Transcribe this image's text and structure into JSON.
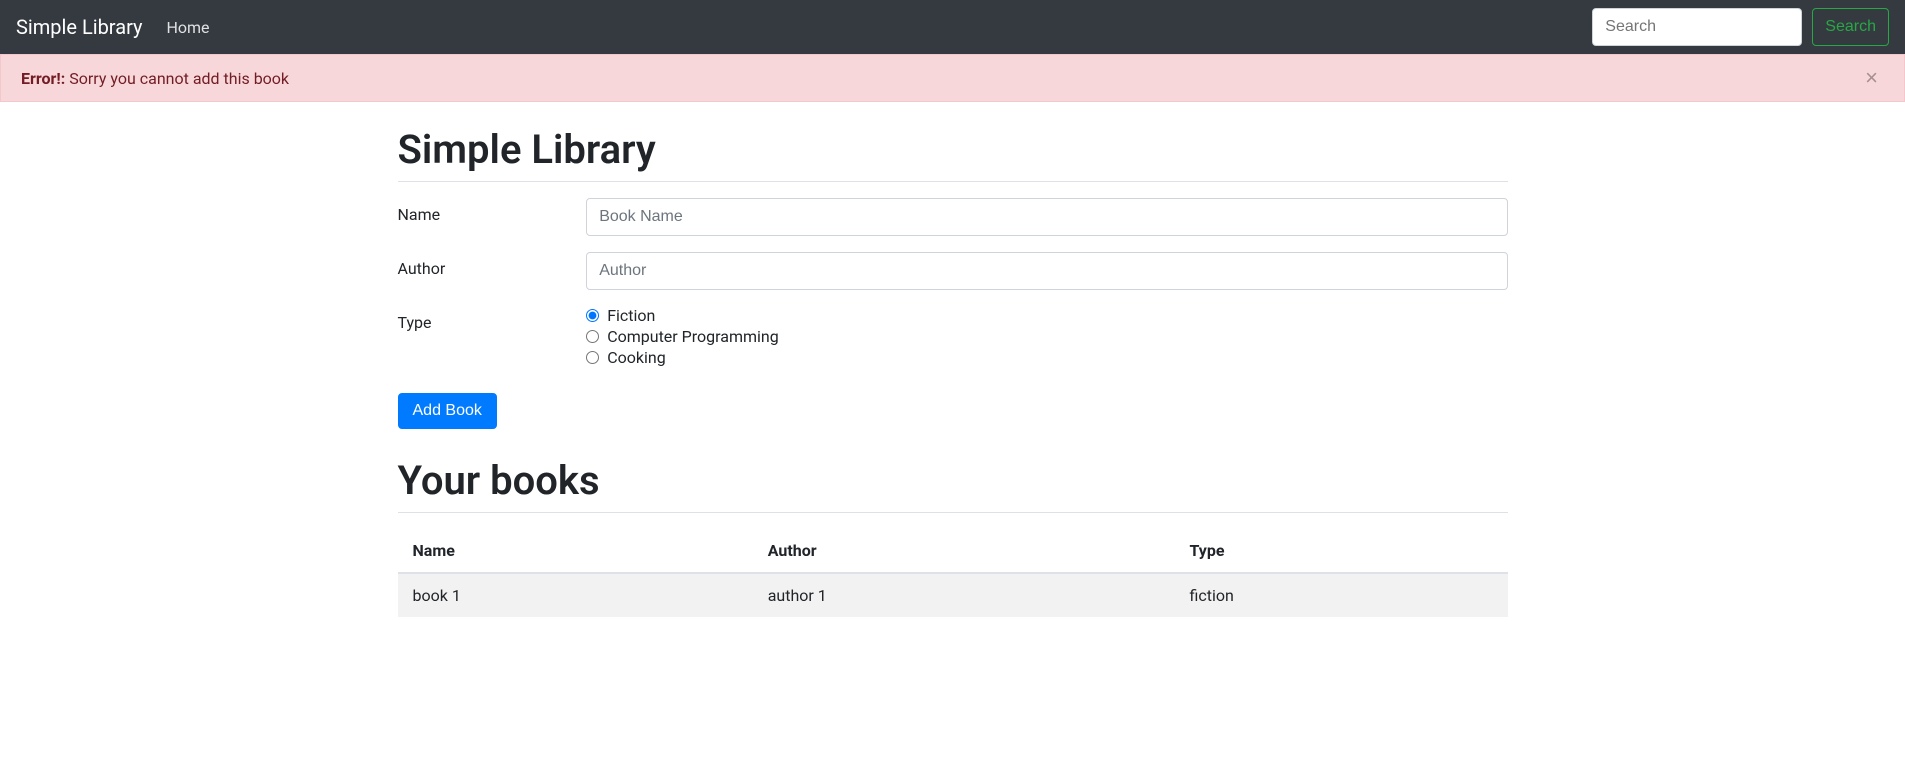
{
  "navbar": {
    "brand": "Simple Library",
    "home": "Home",
    "search_placeholder": "Search",
    "search_button": "Search"
  },
  "alert": {
    "strong": "Error!:",
    "message": " Sorry you cannot add this book",
    "close": "×"
  },
  "main": {
    "title": "Simple Library",
    "form": {
      "name_label": "Name",
      "name_placeholder": "Book Name",
      "author_label": "Author",
      "author_placeholder": "Author",
      "type_label": "Type",
      "types": [
        {
          "label": "Fiction",
          "checked": true
        },
        {
          "label": "Computer Programming",
          "checked": false
        },
        {
          "label": "Cooking",
          "checked": false
        }
      ],
      "submit": "Add Book"
    },
    "books_title": "Your books",
    "table": {
      "headers": [
        "Name",
        "Author",
        "Type"
      ],
      "rows": [
        {
          "name": "book 1",
          "author": "author 1",
          "type": "fiction"
        }
      ]
    }
  }
}
